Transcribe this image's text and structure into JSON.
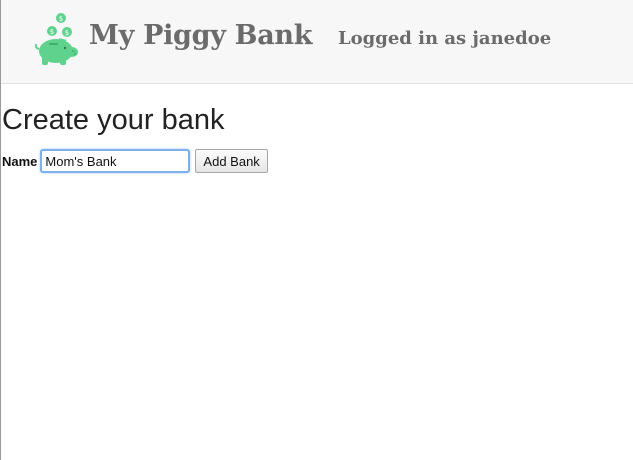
{
  "header": {
    "brand_title": "My Piggy Bank",
    "login_status": "Logged in as janedoe",
    "logo_icon": "piggy-bank-with-coins-icon",
    "logo_color": "#5fd38e"
  },
  "main": {
    "page_title": "Create your bank",
    "form": {
      "name_label": "Name",
      "name_value": "Mom's Bank",
      "add_button_label": "Add Bank"
    }
  }
}
